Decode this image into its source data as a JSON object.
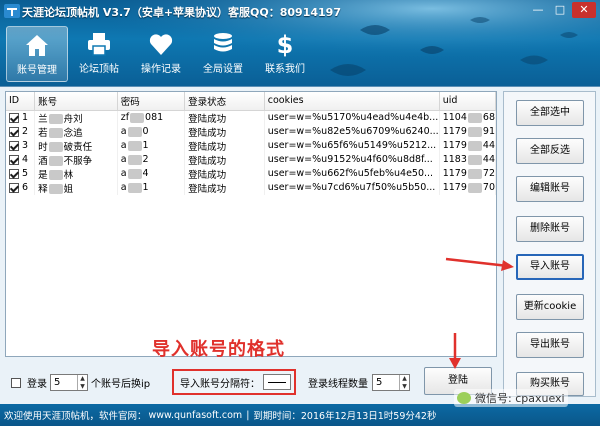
{
  "window": {
    "title": "天涯论坛顶帖机 V3.7（安卓+苹果协议）客服QQ：80914197",
    "controls": [
      "—",
      "□",
      "✕"
    ]
  },
  "nav": [
    {
      "label": "账号管理",
      "icon": "home-icon",
      "active": true
    },
    {
      "label": "论坛顶帖",
      "icon": "printer-icon",
      "active": false
    },
    {
      "label": "操作记录",
      "icon": "heart-icon",
      "active": false
    },
    {
      "label": "全局设置",
      "icon": "database-icon",
      "active": false
    },
    {
      "label": "联系我们",
      "icon": "dollar-icon",
      "active": false
    }
  ],
  "table": {
    "columns": [
      "ID",
      "账号",
      "密码",
      "登录状态",
      "cookies",
      "uid"
    ],
    "rows": [
      {
        "id": "1",
        "account": "兰",
        "account_tail": "舟刘",
        "password": "zf",
        "password_tail": "081",
        "status": "登陆成功",
        "cookies": "user=w=%u5170%u4ead%u4e4b...",
        "uid": "1104",
        "uid_tail": "68"
      },
      {
        "id": "2",
        "account": "若",
        "account_tail": "念追",
        "password": "a",
        "password_tail": "0",
        "status": "登陆成功",
        "cookies": "user=w=%u82e5%u6709%u6240...",
        "uid": "1179",
        "uid_tail": "91"
      },
      {
        "id": "3",
        "account": "时",
        "account_tail": "破责任",
        "password": "a",
        "password_tail": "1",
        "status": "登陆成功",
        "cookies": "user=w=%u65f6%u5149%u5212...",
        "uid": "1179",
        "uid_tail": "44"
      },
      {
        "id": "4",
        "account": "酒",
        "account_tail": "不服争",
        "password": "a",
        "password_tail": "2",
        "status": "登陆成功",
        "cookies": "user=w=%u9152%u4f60%u8d8f...",
        "uid": "1183",
        "uid_tail": "44"
      },
      {
        "id": "5",
        "account": "是",
        "account_tail": "林",
        "password": "a",
        "password_tail": "4",
        "status": "登陆成功",
        "cookies": "user=w=%u662f%u5feb%u4e50...",
        "uid": "1179",
        "uid_tail": "72"
      },
      {
        "id": "6",
        "account": "释",
        "account_tail": "姐",
        "password": "a",
        "password_tail": "1",
        "status": "登陆成功",
        "cookies": "user=w=%u7cd6%u7f50%u5b50...",
        "uid": "1179",
        "uid_tail": "70"
      }
    ]
  },
  "side_buttons": [
    {
      "label": "全部选中"
    },
    {
      "label": "全部反选"
    },
    {
      "label": "编辑账号"
    },
    {
      "label": "删除账号"
    },
    {
      "label": "导入账号"
    },
    {
      "label": "更新cookie"
    },
    {
      "label": "导出账号"
    },
    {
      "label": "购买账号"
    }
  ],
  "options": {
    "login_label": "登录",
    "login_value": "5",
    "login_suffix": "个账号后换ip",
    "separator_label": "导入账号分隔符：",
    "threads_label": "登录线程数量",
    "threads_value": "5",
    "login_button": "登陆"
  },
  "annotation": "导入账号的格式",
  "status_bar": {
    "welcome": "欢迎使用天涯顶帖机，软件官网：",
    "site": "www.qunfasoft.com",
    "expiry": "到期时间：2016年12月13日1时59分42秒"
  },
  "watermark": "微信号: cpaxuexi",
  "colors": {
    "accent": "#0e78b2",
    "highlight_arrow": "#e0312c",
    "annotation": "#e0312c"
  }
}
